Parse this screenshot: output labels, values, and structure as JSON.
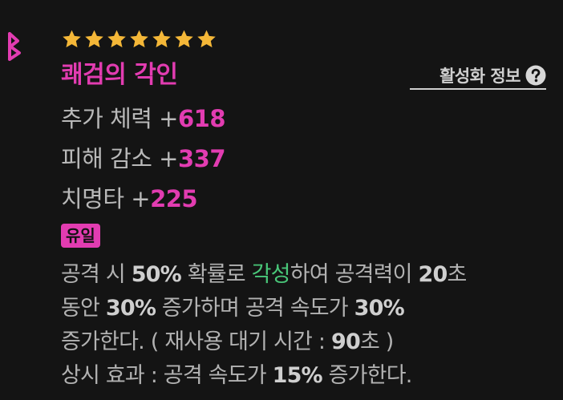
{
  "item": {
    "stars": 7,
    "star_color": "#f4b738",
    "name": "쾌검의 각인",
    "name_color": "#e23cb1",
    "tier_mark_icon": "tier-b-icon"
  },
  "activation": {
    "label": "활성화 정보",
    "icon": "help-icon"
  },
  "stats": [
    {
      "label": "추가 체력 ",
      "plus": "+",
      "value": "618"
    },
    {
      "label": "피해 감소 ",
      "plus": "+",
      "value": "337"
    },
    {
      "label": "치명타 ",
      "plus": "+",
      "value": "225"
    }
  ],
  "badge": {
    "label": "유일"
  },
  "effect": {
    "l1_a": "공격 시 ",
    "l1_b": "50%",
    "l1_c": " 확률로 ",
    "l1_d": "각성",
    "l1_e": "하여 공격력이 ",
    "l1_f": "20",
    "l1_g": "초",
    "l2_a": "동안 ",
    "l2_b": "30%",
    "l2_c": " 증가하며 공격 속도가 ",
    "l2_d": "30%",
    "l3_a": "증가한다. ( 재사용 대기 시간 : ",
    "l3_b": "90",
    "l3_c": "초 )",
    "l4_a": "상시 효과 : 공격 속도가 ",
    "l4_b": "15%",
    "l4_c": " 증가한다.",
    "highlight_color": "#49c779"
  }
}
